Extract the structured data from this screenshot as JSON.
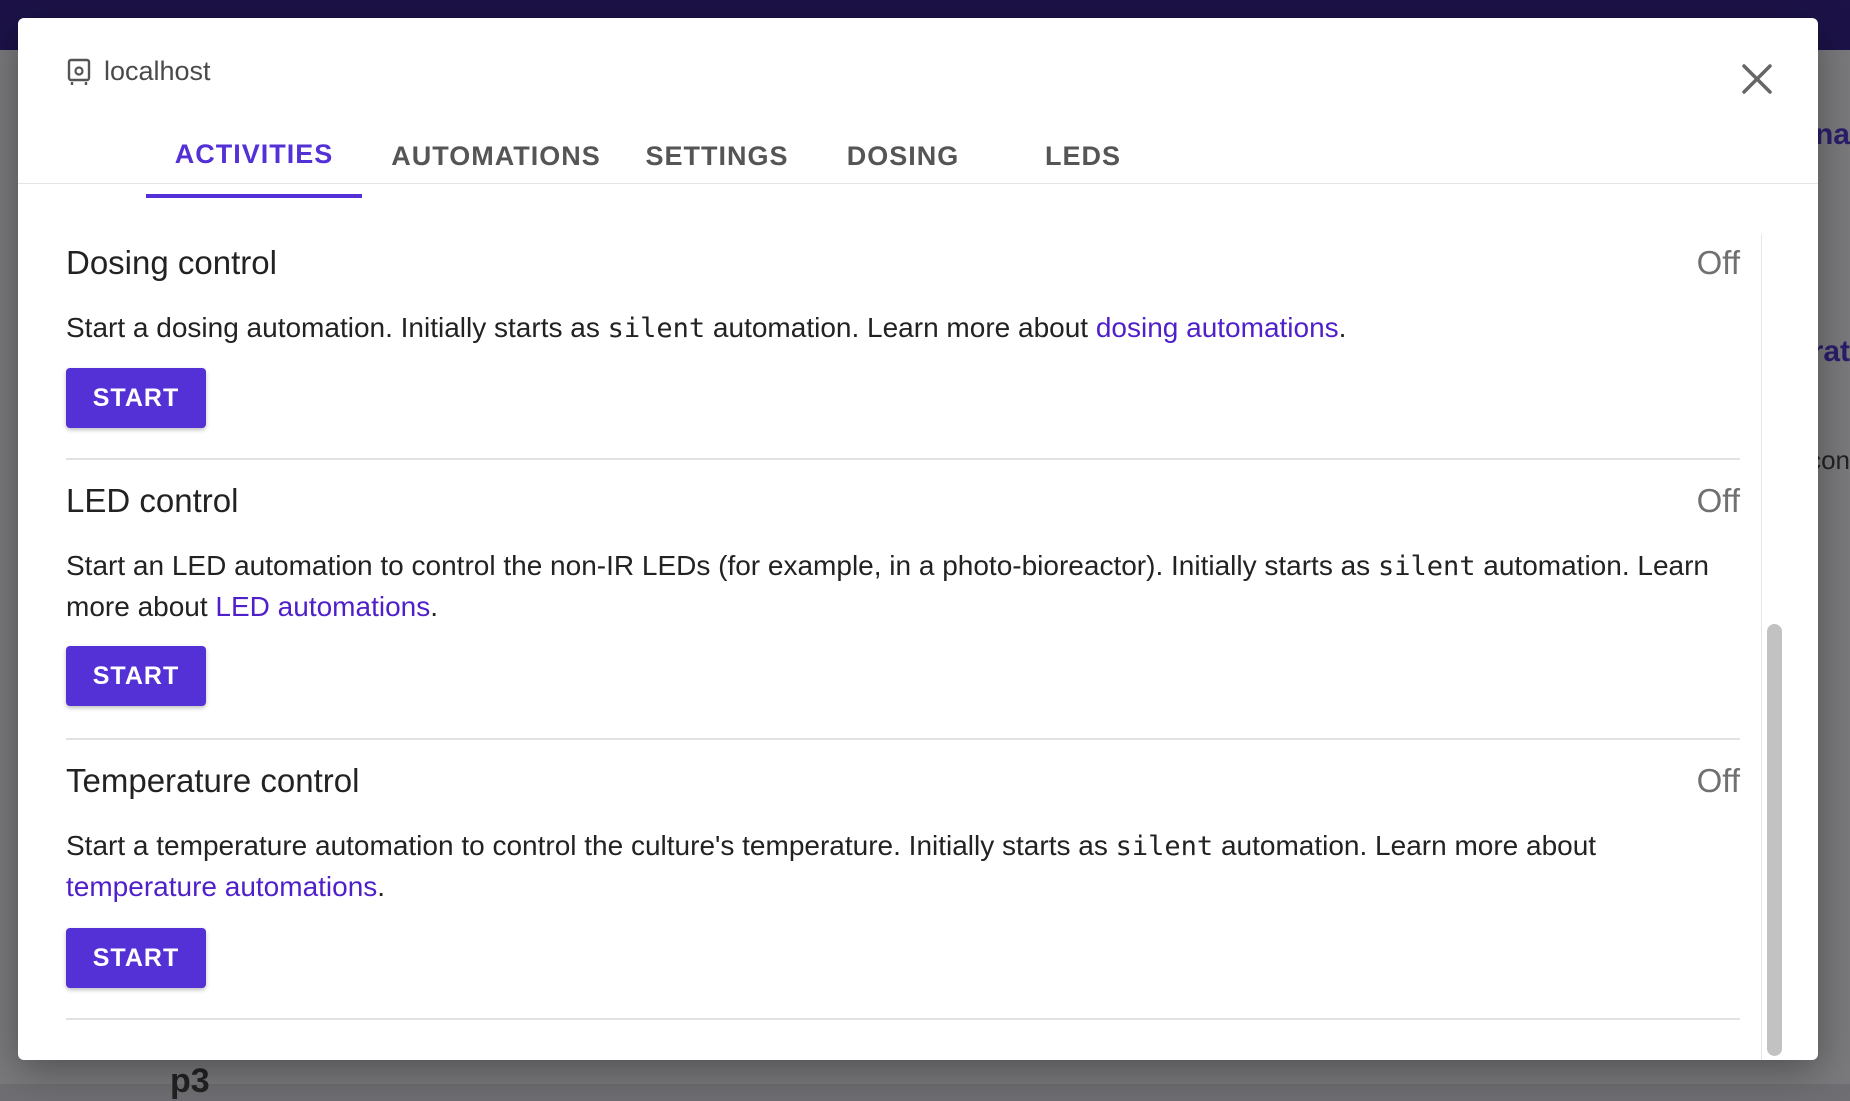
{
  "background": {
    "fragment_a": "na",
    "fragment_b": "rat",
    "fragment_c": "con",
    "fragment_d": "p3"
  },
  "dialog": {
    "host": "localhost",
    "tabs": [
      {
        "label": "ACTIVITIES",
        "active": true
      },
      {
        "label": "AUTOMATIONS",
        "active": false
      },
      {
        "label": "SETTINGS",
        "active": false
      },
      {
        "label": "DOSING",
        "active": false
      },
      {
        "label": "LEDS",
        "active": false
      }
    ],
    "sections": [
      {
        "title": "Dosing control",
        "status": "Off",
        "desc_pre": "Start a dosing automation. Initially starts as ",
        "code": "silent",
        "desc_mid": " automation. Learn more about ",
        "link": "dosing automations",
        "desc_post": ".",
        "button": "START"
      },
      {
        "title": "LED control",
        "status": "Off",
        "desc_pre": "Start an LED automation to control the non-IR LEDs (for example, in a photo-bioreactor). Initially starts as ",
        "code": "silent",
        "desc_mid": " automation. Learn more about ",
        "link": "LED automations",
        "desc_post": ".",
        "button": "START"
      },
      {
        "title": "Temperature control",
        "status": "Off",
        "desc_pre": "Start a temperature automation to control the culture's temperature. Initially starts as ",
        "code": "silent",
        "desc_mid": " automation. Learn more about ",
        "link": "temperature automations",
        "desc_post": ".",
        "button": "START"
      }
    ]
  },
  "colors": {
    "accent": "#5331d6",
    "link": "#4f1fc9",
    "topbar": "#1c1248"
  },
  "icons": {
    "host": "host-server-icon",
    "close": "close-icon"
  }
}
